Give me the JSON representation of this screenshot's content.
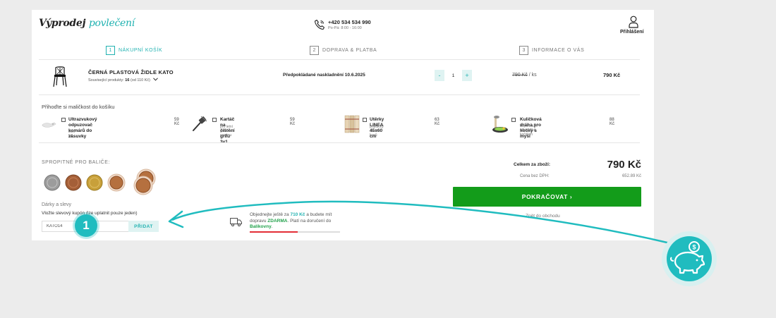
{
  "header": {
    "logo_part1": "Výprodej",
    "logo_part2": "povlečení",
    "phone": "+420 534 534 990",
    "hours": "Po-Pá: 8:00 - 16:00",
    "login_label": "Přihlášení"
  },
  "steps": [
    {
      "num": "1",
      "label": "NÁKUPNÍ KOŠÍK"
    },
    {
      "num": "2",
      "label": "DOPRAVA & PLATBA"
    },
    {
      "num": "3",
      "label": "INFORMACE O VÁS"
    }
  ],
  "product": {
    "name": "ČERNÁ PLASTOVÁ ŽIDLE KATO",
    "related_label": "Související produkty:",
    "related_count": "16",
    "related_price": "(od 110 Kč)",
    "delivery": "Předpokládané naskladnění 10.6.2025",
    "qty_minus": "-",
    "qty_value": "1",
    "qty_plus": "+",
    "unit_price": "790 Kč",
    "unit_suffix": "/ ks",
    "total": "790 Kč"
  },
  "addons": {
    "title": "Přihoďte si maličkost do košíku",
    "items": [
      {
        "name_line1": "Ultrazvukový odpuzovač komárů do",
        "name_line2": "zásuvky",
        "sub_line1": "letní hit",
        "sub_line2": "",
        "price": "59 Kč"
      },
      {
        "name_line1": "Kartáč na čištění grilu 3v1",
        "name_line2": "",
        "sub_line1": "pro letní grilovací sezónu",
        "sub_line2": "",
        "price": "59 Kč"
      },
      {
        "name_line1": "Utěrky LINEA 45x60 cm",
        "name_line2": "",
        "sub_line1": "praktický set 3 kusů",
        "sub_line2": "",
        "price": "63 Kč"
      },
      {
        "name_line1": "Kuličková dráha pro kočky s myší",
        "name_line2": "",
        "sub_line1": "doporučuje 10 z 10 kočičích",
        "sub_line2": "zákazníků",
        "price": "88 Kč"
      }
    ]
  },
  "tips": {
    "title": "SPROPITNÉ PRO BALIČE:"
  },
  "discounts": {
    "title": "Dárky a slevy",
    "label": "Vložte slevový kupón (lze uplatnit pouze jeden)",
    "code_value": "KATO14",
    "apply_label": "PŘIDAT"
  },
  "shipping": {
    "t1": "Objednejte ještě za ",
    "amount": "710 Kč",
    "t2": " a budete mít dopravu ",
    "free": "ZDARMA",
    "t3": ". Platí na doručení do ",
    "carrier": "Balíkovny",
    "t4": ".",
    "progress": 0.53,
    "bar_color": "#e32d36"
  },
  "summary": {
    "total_label": "Celkem za zboží:",
    "total_value": "790 Kč",
    "net_label": "Cena bez DPH:",
    "net_value": "652.89 Kč",
    "continue_label": "POKRAČOVAT ›",
    "back_label": "Zpět do obchodu"
  },
  "annotation": {
    "badge_number": "1"
  },
  "colors": {
    "accent": "#21b2b1",
    "continue": "#139c1a",
    "arrow": "#20bcbf"
  }
}
